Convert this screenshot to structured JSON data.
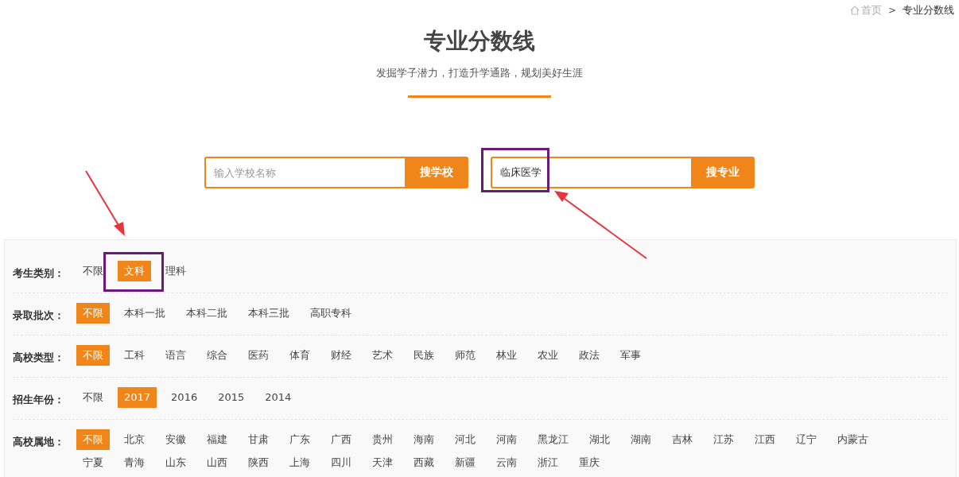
{
  "breadcrumb": {
    "home": "首页",
    "separator": ">",
    "current": "专业分数线"
  },
  "header": {
    "title": "专业分数线",
    "subtitle": "发掘学子潜力，打造升学通路，规划美好生涯"
  },
  "searches": [
    {
      "placeholder": "输入学校名称",
      "button": "搜学校",
      "highlighted": false
    },
    {
      "value": "临床医学",
      "button": "搜专业",
      "highlighted": true
    }
  ],
  "filters": [
    {
      "label": "考生类别：",
      "options": [
        {
          "text": "不限",
          "selected": false,
          "highlighted": false
        },
        {
          "text": "文科",
          "selected": true,
          "highlighted": true
        },
        {
          "text": "理科",
          "selected": false,
          "highlighted": false
        }
      ]
    },
    {
      "label": "录取批次：",
      "options": [
        {
          "text": "不限",
          "selected": true
        },
        {
          "text": "本科一批",
          "selected": false
        },
        {
          "text": "本科二批",
          "selected": false
        },
        {
          "text": "本科三批",
          "selected": false
        },
        {
          "text": "高职专科",
          "selected": false
        }
      ]
    },
    {
      "label": "高校类型：",
      "options": [
        {
          "text": "不限",
          "selected": true
        },
        {
          "text": "工科",
          "selected": false
        },
        {
          "text": "语言",
          "selected": false
        },
        {
          "text": "综合",
          "selected": false
        },
        {
          "text": "医药",
          "selected": false
        },
        {
          "text": "体育",
          "selected": false
        },
        {
          "text": "财经",
          "selected": false
        },
        {
          "text": "艺术",
          "selected": false
        },
        {
          "text": "民族",
          "selected": false
        },
        {
          "text": "师范",
          "selected": false
        },
        {
          "text": "林业",
          "selected": false
        },
        {
          "text": "农业",
          "selected": false
        },
        {
          "text": "政法",
          "selected": false
        },
        {
          "text": "军事",
          "selected": false
        }
      ]
    },
    {
      "label": "招生年份：",
      "options": [
        {
          "text": "不限",
          "selected": false
        },
        {
          "text": "2017",
          "selected": true
        },
        {
          "text": "2016",
          "selected": false
        },
        {
          "text": "2015",
          "selected": false
        },
        {
          "text": "2014",
          "selected": false
        }
      ]
    },
    {
      "label": "高校属地：",
      "options": [
        {
          "text": "不限",
          "selected": true
        },
        {
          "text": "北京",
          "selected": false
        },
        {
          "text": "安徽",
          "selected": false
        },
        {
          "text": "福建",
          "selected": false
        },
        {
          "text": "甘肃",
          "selected": false
        },
        {
          "text": "广东",
          "selected": false
        },
        {
          "text": "广西",
          "selected": false
        },
        {
          "text": "贵州",
          "selected": false
        },
        {
          "text": "海南",
          "selected": false
        },
        {
          "text": "河北",
          "selected": false
        },
        {
          "text": "河南",
          "selected": false
        },
        {
          "text": "黑龙江",
          "selected": false
        },
        {
          "text": "湖北",
          "selected": false
        },
        {
          "text": "湖南",
          "selected": false
        },
        {
          "text": "吉林",
          "selected": false
        },
        {
          "text": "江苏",
          "selected": false
        },
        {
          "text": "江西",
          "selected": false
        },
        {
          "text": "辽宁",
          "selected": false
        },
        {
          "text": "内蒙古",
          "selected": false
        },
        {
          "text": "宁夏",
          "selected": false
        },
        {
          "text": "青海",
          "selected": false
        },
        {
          "text": "山东",
          "selected": false
        },
        {
          "text": "山西",
          "selected": false
        },
        {
          "text": "陕西",
          "selected": false
        },
        {
          "text": "上海",
          "selected": false
        },
        {
          "text": "四川",
          "selected": false
        },
        {
          "text": "天津",
          "selected": false
        },
        {
          "text": "西藏",
          "selected": false
        },
        {
          "text": "新疆",
          "selected": false
        },
        {
          "text": "云南",
          "selected": false
        },
        {
          "text": "浙江",
          "selected": false
        },
        {
          "text": "重庆",
          "selected": false
        }
      ]
    }
  ]
}
